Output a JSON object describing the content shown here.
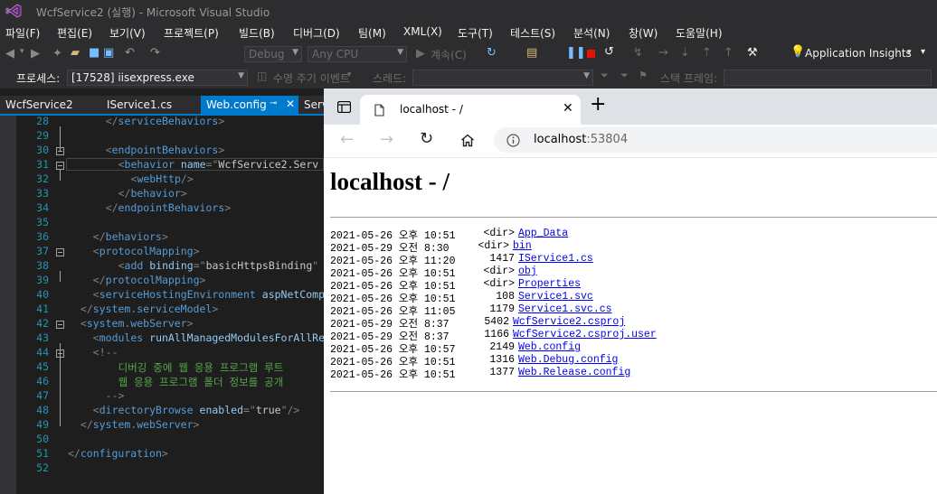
{
  "window": {
    "title": "WcfService2 (실행) - Microsoft Visual Studio"
  },
  "menu": [
    "파일(F)",
    "편집(E)",
    "보기(V)",
    "프로젝트(P)",
    "빌드(B)",
    "디버그(D)",
    "팀(M)",
    "XML(X)",
    "도구(T)",
    "테스트(S)",
    "분석(N)",
    "창(W)",
    "도움말(H)"
  ],
  "toolbar": {
    "config": "Debug",
    "platform": "Any CPU",
    "continue": "계속(C)",
    "app_insights": "Application Insights"
  },
  "debug_bar": {
    "process_label": "프로세스:",
    "process_value": "[17528] iisexpress.exe",
    "lifecycle": "수명 주기 이벤트",
    "thread_label": "스레드:",
    "stackframe_label": "스택 프레임:"
  },
  "doc_tabs": [
    "WcfService2",
    "IService1.cs",
    "Web.config",
    "Serv"
  ],
  "editor": {
    "lines": [
      {
        "n": "28",
        "indent": 6,
        "parts": [
          [
            "p",
            "</"
          ],
          [
            "t",
            "serviceBehaviors"
          ],
          [
            "p",
            ">"
          ]
        ]
      },
      {
        "n": "29",
        "indent": 0,
        "parts": []
      },
      {
        "n": "30",
        "indent": 6,
        "parts": [
          [
            "p",
            "<"
          ],
          [
            "t",
            "endpointBehaviors"
          ],
          [
            "p",
            ">"
          ]
        ]
      },
      {
        "n": "31",
        "indent": 8,
        "parts": [
          [
            "p",
            "<"
          ],
          [
            "t",
            "behavior"
          ],
          [
            "p",
            " "
          ],
          [
            "a",
            "name"
          ],
          [
            "p",
            "=\""
          ],
          [
            "s",
            "WcfService2.Serv"
          ]
        ]
      },
      {
        "n": "32",
        "indent": 10,
        "parts": [
          [
            "p",
            "<"
          ],
          [
            "t",
            "webHttp"
          ],
          [
            "p",
            "/>"
          ]
        ]
      },
      {
        "n": "33",
        "indent": 8,
        "parts": [
          [
            "p",
            "</"
          ],
          [
            "t",
            "behavior"
          ],
          [
            "p",
            ">"
          ]
        ]
      },
      {
        "n": "34",
        "indent": 6,
        "parts": [
          [
            "p",
            "</"
          ],
          [
            "t",
            "endpointBehaviors"
          ],
          [
            "p",
            ">"
          ]
        ]
      },
      {
        "n": "35",
        "indent": 0,
        "parts": []
      },
      {
        "n": "36",
        "indent": 4,
        "parts": [
          [
            "p",
            "</"
          ],
          [
            "t",
            "behaviors"
          ],
          [
            "p",
            ">"
          ]
        ]
      },
      {
        "n": "37",
        "indent": 4,
        "parts": [
          [
            "p",
            "<"
          ],
          [
            "t",
            "protocolMapping"
          ],
          [
            "p",
            ">"
          ]
        ]
      },
      {
        "n": "38",
        "indent": 8,
        "parts": [
          [
            "p",
            "<"
          ],
          [
            "t",
            "add"
          ],
          [
            "p",
            " "
          ],
          [
            "a",
            "binding"
          ],
          [
            "p",
            "=\""
          ],
          [
            "s",
            "basicHttpsBinding"
          ],
          [
            "p",
            "\""
          ]
        ]
      },
      {
        "n": "39",
        "indent": 4,
        "parts": [
          [
            "p",
            "</"
          ],
          [
            "t",
            "protocolMapping"
          ],
          [
            "p",
            ">"
          ]
        ]
      },
      {
        "n": "40",
        "indent": 4,
        "parts": [
          [
            "p",
            "<"
          ],
          [
            "t",
            "serviceHostingEnvironment"
          ],
          [
            "p",
            " "
          ],
          [
            "a",
            "aspNetComp"
          ]
        ]
      },
      {
        "n": "41",
        "indent": 2,
        "parts": [
          [
            "p",
            "</"
          ],
          [
            "t",
            "system.serviceModel"
          ],
          [
            "p",
            ">"
          ]
        ]
      },
      {
        "n": "42",
        "indent": 2,
        "parts": [
          [
            "p",
            "<"
          ],
          [
            "t",
            "system.webServer"
          ],
          [
            "p",
            ">"
          ]
        ]
      },
      {
        "n": "43",
        "indent": 4,
        "parts": [
          [
            "p",
            "<"
          ],
          [
            "t",
            "modules"
          ],
          [
            "p",
            " "
          ],
          [
            "a",
            "runAllManagedModulesForAllRe"
          ]
        ]
      },
      {
        "n": "44",
        "indent": 4,
        "parts": [
          [
            "p",
            "<!--"
          ]
        ]
      },
      {
        "n": "45",
        "indent": 8,
        "parts": [
          [
            "c",
            "디버깅 중에 웹 응용 프로그램 루트"
          ]
        ]
      },
      {
        "n": "46",
        "indent": 8,
        "parts": [
          [
            "c",
            "웹 응용 프로그램 폴더 정보를 공개"
          ]
        ]
      },
      {
        "n": "47",
        "indent": 6,
        "parts": [
          [
            "p",
            "-->"
          ]
        ]
      },
      {
        "n": "48",
        "indent": 4,
        "parts": [
          [
            "p",
            "<"
          ],
          [
            "t",
            "directoryBrowse"
          ],
          [
            "p",
            " "
          ],
          [
            "a",
            "enabled"
          ],
          [
            "p",
            "=\""
          ],
          [
            "s",
            "true"
          ],
          [
            "p",
            "\"/>"
          ]
        ]
      },
      {
        "n": "49",
        "indent": 2,
        "parts": [
          [
            "p",
            "</"
          ],
          [
            "t",
            "system.webServer"
          ],
          [
            "p",
            ">"
          ]
        ]
      },
      {
        "n": "50",
        "indent": 0,
        "parts": []
      },
      {
        "n": "51",
        "indent": 0,
        "parts": [
          [
            "p",
            "</"
          ],
          [
            "t",
            "configuration"
          ],
          [
            "p",
            ">"
          ]
        ]
      },
      {
        "n": "52",
        "indent": 0,
        "parts": []
      }
    ]
  },
  "browser": {
    "tab_title": "localhost - /",
    "address_host": "localhost",
    "address_port": ":53804",
    "heading": "localhost - /",
    "entries": [
      {
        "date": "2021-05-26 오후 10:51",
        "size": "<dir>",
        "name": "App_Data"
      },
      {
        "date": "2021-05-29 오전 8:30",
        "size": "<dir>",
        "name": "bin"
      },
      {
        "date": "2021-05-26 오후 11:20",
        "size": "1417",
        "name": "IService1.cs"
      },
      {
        "date": "2021-05-26 오후 10:51",
        "size": "<dir>",
        "name": "obj"
      },
      {
        "date": "2021-05-26 오후 10:51",
        "size": "<dir>",
        "name": "Properties"
      },
      {
        "date": "2021-05-26 오후 10:51",
        "size": "108",
        "name": "Service1.svc"
      },
      {
        "date": "2021-05-26 오후 11:05",
        "size": "1179",
        "name": "Service1.svc.cs"
      },
      {
        "date": "2021-05-29 오전 8:37",
        "size": "5402",
        "name": "WcfService2.csproj"
      },
      {
        "date": "2021-05-29 오전 8:37",
        "size": "1166",
        "name": "WcfService2.csproj.user"
      },
      {
        "date": "2021-05-26 오후 10:57",
        "size": "2149",
        "name": "Web.config"
      },
      {
        "date": "2021-05-26 오후 10:51",
        "size": "1316",
        "name": "Web.Debug.config"
      },
      {
        "date": "2021-05-26 오후 10:51",
        "size": "1377",
        "name": "Web.Release.config"
      }
    ]
  },
  "colors": {
    "vs_chrome": "#2d2d30",
    "editor_bg": "#1e1e1e",
    "accent": "#007acc",
    "link": "#0000ee"
  }
}
